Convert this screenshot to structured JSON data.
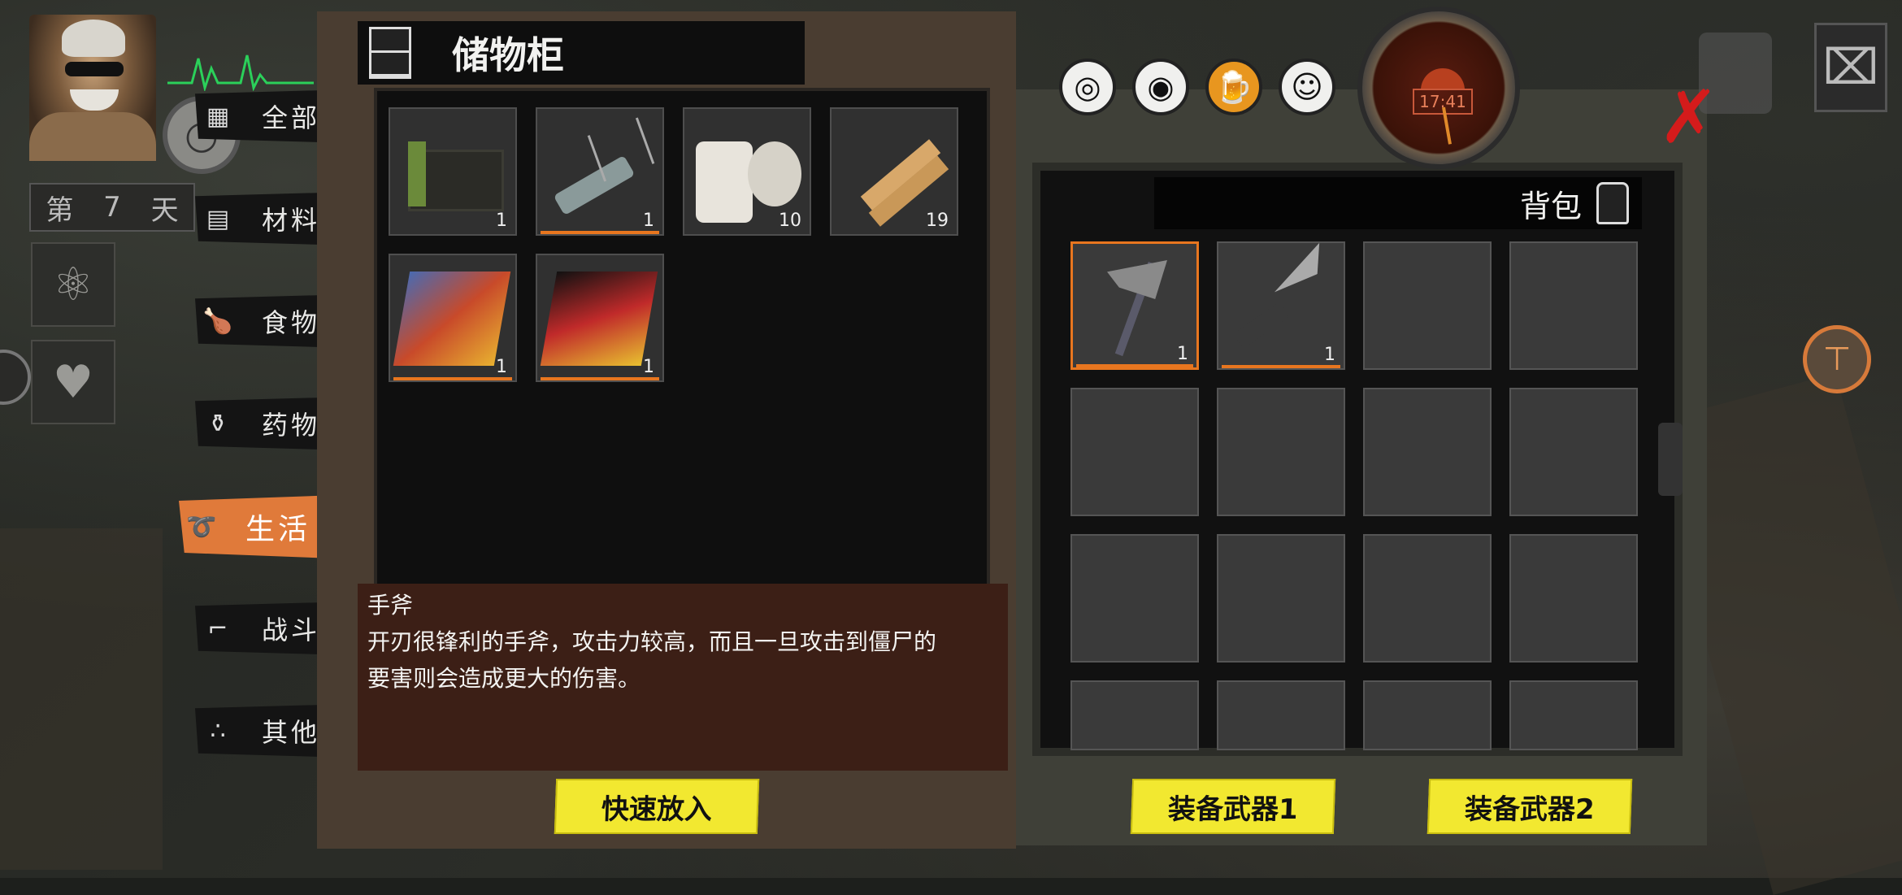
{
  "player": {
    "day_label_prefix": "第",
    "day_number": "7",
    "day_label_suffix": "天"
  },
  "categories": [
    {
      "label": "全部",
      "icon": "grid-icon"
    },
    {
      "label": "材料",
      "icon": "planks-icon"
    },
    {
      "label": "食物",
      "icon": "chicken-icon"
    },
    {
      "label": "药物",
      "icon": "pill-bottle-icon"
    },
    {
      "label": "生活",
      "icon": "rope-icon",
      "active": true
    },
    {
      "label": "战斗",
      "icon": "pistol-icon"
    },
    {
      "label": "其他",
      "icon": "dots-icon"
    }
  ],
  "storage": {
    "title": "储物柜",
    "items": [
      {
        "name": "box",
        "count": "1",
        "has_bar": false
      },
      {
        "name": "lockpick-set",
        "count": "1",
        "has_bar": true
      },
      {
        "name": "bandage-roll",
        "count": "10",
        "has_bar": false
      },
      {
        "name": "wooden-planks",
        "count": "19",
        "has_bar": false
      },
      {
        "name": "comic-magazine",
        "count": "1",
        "has_bar": true
      },
      {
        "name": "discovery-magazine",
        "count": "1",
        "has_bar": true
      }
    ]
  },
  "description": {
    "title": "手斧",
    "line1": "开刃很锋利的手斧，攻击力较高，而且一旦攻击到僵尸的",
    "line2": "要害则会造成更大的伤害。"
  },
  "buttons": {
    "quick_put": "快速放入",
    "equip1": "装备武器1",
    "equip2": "装备武器2"
  },
  "backpack": {
    "title": "背包",
    "items": [
      {
        "name": "hand-axe",
        "count": "1",
        "selected": true
      },
      {
        "name": "combat-knife",
        "count": "1",
        "selected": false
      }
    ]
  },
  "clock": {
    "time": "17:41"
  },
  "status_icons": [
    "pill-icon",
    "eye-icon",
    "beer-icon",
    "smile-icon"
  ],
  "colors": {
    "accent_orange": "#e8761f",
    "button_yellow": "#f2e830",
    "close_red": "#d41b1b"
  }
}
